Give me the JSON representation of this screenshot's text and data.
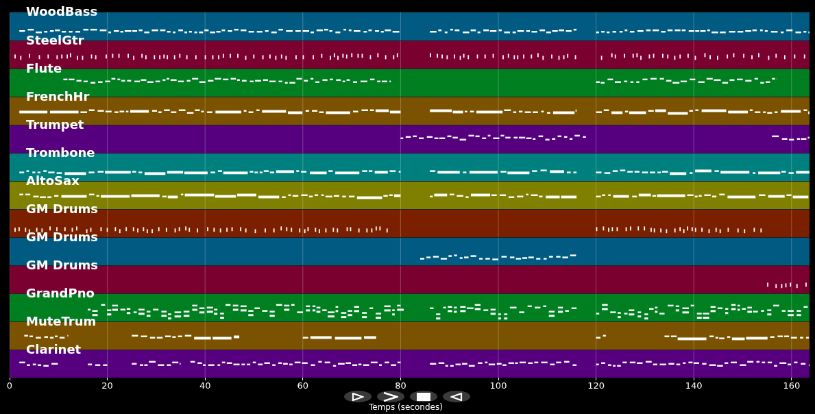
{
  "tracks": [
    {
      "name": "WoodBass",
      "color": "#005a82"
    },
    {
      "name": "SteelGtr",
      "color": "#7a0030"
    },
    {
      "name": "Flute",
      "color": "#007f20"
    },
    {
      "name": "FrenchHr",
      "color": "#7a5200"
    },
    {
      "name": "Trumpet",
      "color": "#560080"
    },
    {
      "name": "Trombone",
      "color": "#007f7f"
    },
    {
      "name": "AltoSax",
      "color": "#7f7f00"
    },
    {
      "name": "GM Drums",
      "color": "#7a2000"
    },
    {
      "name": "GM Drums",
      "color": "#005a82"
    },
    {
      "name": "GM Drums",
      "color": "#7a0030"
    },
    {
      "name": "GrandPno",
      "color": "#007f20"
    },
    {
      "name": "MuteTrum",
      "color": "#7a5200"
    },
    {
      "name": "Clarinet",
      "color": "#560080"
    }
  ],
  "axis": {
    "label": "Temps (secondes)",
    "ticks": [
      "0",
      "20",
      "40",
      "60",
      "80",
      "100",
      "120",
      "140",
      "160"
    ]
  },
  "controls": [
    {
      "kind": "play"
    },
    {
      "kind": "forward"
    },
    {
      "kind": "stop"
    },
    {
      "kind": "back"
    }
  ]
}
